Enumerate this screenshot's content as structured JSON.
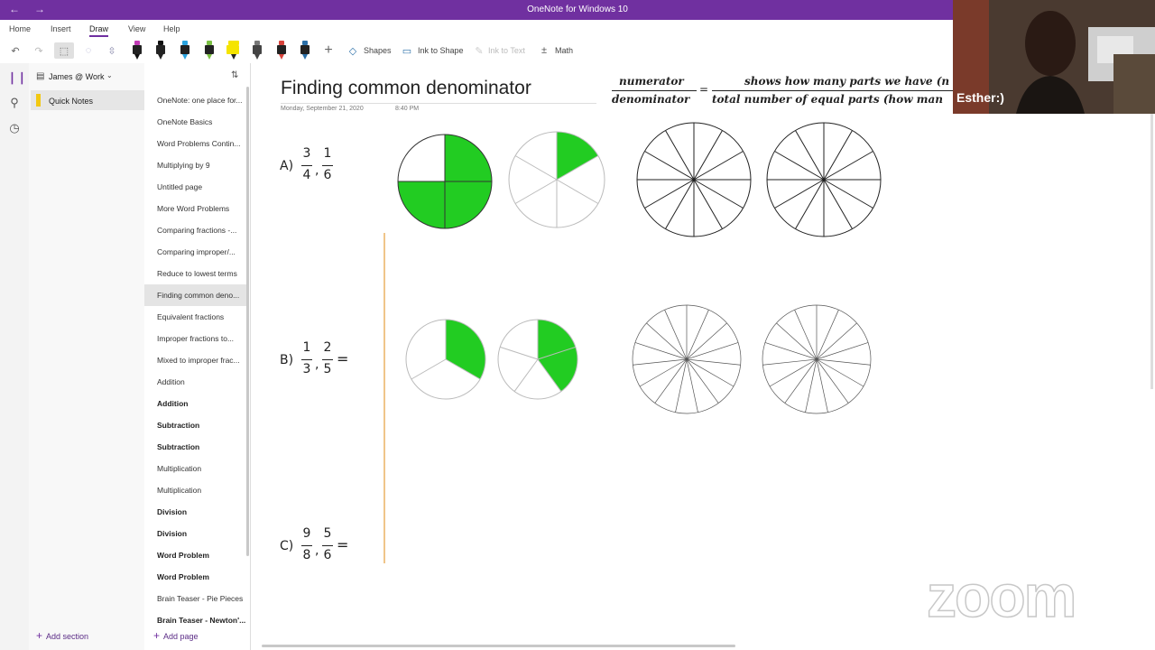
{
  "window": {
    "title": "OneNote for Windows 10",
    "back_glyph": "←",
    "forward_glyph": "→"
  },
  "menu": {
    "items": [
      "Home",
      "Insert",
      "Draw",
      "View",
      "Help"
    ],
    "active": "Draw"
  },
  "toolbar": {
    "shapes_label": "Shapes",
    "ink_to_shape_label": "Ink to Shape",
    "ink_to_text_label": "Ink to Text",
    "math_label": "Math",
    "pen_colors": [
      "#111111",
      "#111111",
      "#29a3e0",
      "#7bc043",
      "#f5e400",
      "#555555",
      "#d9433b",
      "#2a6fa8"
    ]
  },
  "notebook": {
    "name": "James @ Work",
    "section": "Quick Notes"
  },
  "pages": [
    {
      "label": "OneNote: one place for...",
      "bold": false
    },
    {
      "label": "OneNote Basics",
      "bold": false
    },
    {
      "label": "Word Problems Contin...",
      "bold": false
    },
    {
      "label": "Multiplying by 9",
      "bold": false
    },
    {
      "label": "Untitled page",
      "bold": false
    },
    {
      "label": "More Word Problems",
      "bold": false
    },
    {
      "label": "Comparing fractions -...",
      "bold": false
    },
    {
      "label": "Comparing improper/...",
      "bold": false
    },
    {
      "label": "Reduce to lowest terms",
      "bold": false
    },
    {
      "label": "Finding common deno...",
      "bold": false,
      "selected": true
    },
    {
      "label": "Equivalent fractions",
      "bold": false
    },
    {
      "label": "Improper fractions to...",
      "bold": false
    },
    {
      "label": "Mixed to improper frac...",
      "bold": false
    },
    {
      "label": "Addition",
      "bold": false
    },
    {
      "label": "Addition",
      "bold": true
    },
    {
      "label": "Subtraction",
      "bold": true
    },
    {
      "label": "Subtraction",
      "bold": true
    },
    {
      "label": "Multiplication",
      "bold": false
    },
    {
      "label": "Multiplication",
      "bold": false
    },
    {
      "label": "Division",
      "bold": true
    },
    {
      "label": "Division",
      "bold": true
    },
    {
      "label": "Word Problem",
      "bold": true
    },
    {
      "label": "Word Problem",
      "bold": true
    },
    {
      "label": "Brain Teaser - Pie Pieces",
      "bold": false
    },
    {
      "label": "Brain Teaser - Newton'...",
      "bold": true
    }
  ],
  "footer": {
    "add_section": "Add section",
    "add_page": "Add page"
  },
  "note": {
    "title": "Finding common denominator",
    "date": "Monday, September 21, 2020",
    "time": "8:40 PM",
    "formula": {
      "lhs_num": "numerator",
      "lhs_den": "denominator",
      "rhs_num": "shows how many parts we have (n",
      "rhs_den": "total number of equal parts (how man"
    },
    "problems": [
      {
        "label": "A)",
        "f1": [
          "3",
          "4"
        ],
        "f2": [
          "1",
          "6"
        ],
        "eq": ""
      },
      {
        "label": "B)",
        "f1": [
          "1",
          "3"
        ],
        "f2": [
          "2",
          "5"
        ],
        "eq": "="
      },
      {
        "label": "C)",
        "f1": [
          "9",
          "8"
        ],
        "f2": [
          "5",
          "6"
        ],
        "eq": "="
      }
    ],
    "fill_color": "#22cc22"
  },
  "webcam": {
    "name": "Esther:)"
  },
  "overlay": {
    "logo": "zoom"
  }
}
